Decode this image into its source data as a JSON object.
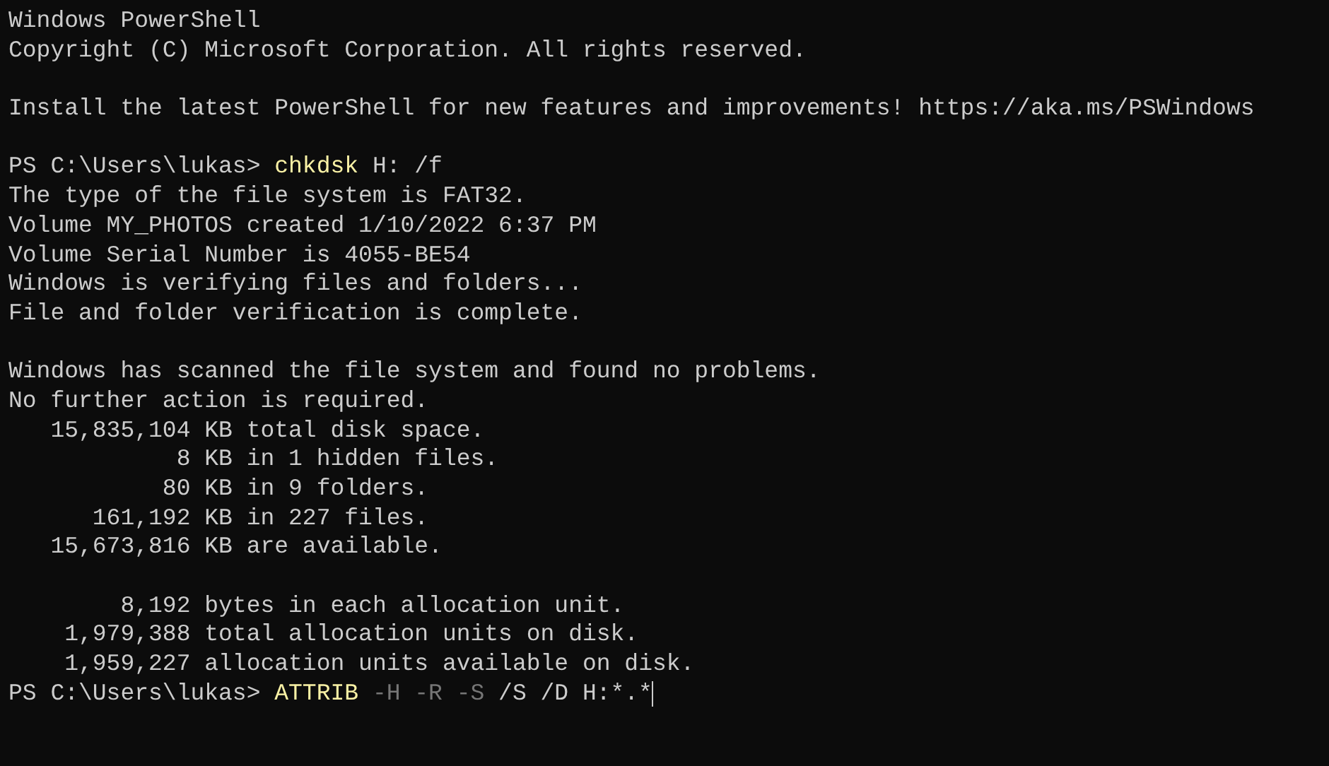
{
  "lines": [
    {
      "kind": "output",
      "text": "Windows PowerShell"
    },
    {
      "kind": "output",
      "text": "Copyright (C) Microsoft Corporation. All rights reserved."
    },
    {
      "kind": "blank"
    },
    {
      "kind": "output",
      "text": "Install the latest PowerShell for new features and improvements! https://aka.ms/PSWindows"
    },
    {
      "kind": "blank"
    },
    {
      "kind": "prompt",
      "prompt": "PS C:\\Users\\lukas>",
      "parts": [
        {
          "kind": "command",
          "text": "chkdsk"
        },
        {
          "kind": "argument",
          "text": "H:"
        },
        {
          "kind": "argument",
          "text": "/f"
        }
      ],
      "cursor": false
    },
    {
      "kind": "output",
      "text": "The type of the file system is FAT32."
    },
    {
      "kind": "output",
      "text": "Volume MY_PHOTOS created 1/10/2022 6:37 PM"
    },
    {
      "kind": "output",
      "text": "Volume Serial Number is 4055-BE54"
    },
    {
      "kind": "output",
      "text": "Windows is verifying files and folders..."
    },
    {
      "kind": "output",
      "text": "File and folder verification is complete."
    },
    {
      "kind": "blank"
    },
    {
      "kind": "output",
      "text": "Windows has scanned the file system and found no problems."
    },
    {
      "kind": "output",
      "text": "No further action is required."
    },
    {
      "kind": "output",
      "text": "   15,835,104 KB total disk space."
    },
    {
      "kind": "output",
      "text": "            8 KB in 1 hidden files."
    },
    {
      "kind": "output",
      "text": "           80 KB in 9 folders."
    },
    {
      "kind": "output",
      "text": "      161,192 KB in 227 files."
    },
    {
      "kind": "output",
      "text": "   15,673,816 KB are available."
    },
    {
      "kind": "blank"
    },
    {
      "kind": "output",
      "text": "        8,192 bytes in each allocation unit."
    },
    {
      "kind": "output",
      "text": "    1,979,388 total allocation units on disk."
    },
    {
      "kind": "output",
      "text": "    1,959,227 allocation units available on disk."
    },
    {
      "kind": "prompt",
      "prompt": "PS C:\\Users\\lukas>",
      "parts": [
        {
          "kind": "command",
          "text": "ATTRIB"
        },
        {
          "kind": "parameter",
          "text": "-H"
        },
        {
          "kind": "parameter",
          "text": "-R"
        },
        {
          "kind": "parameter",
          "text": "-S"
        },
        {
          "kind": "argument",
          "text": "/S"
        },
        {
          "kind": "argument",
          "text": "/D"
        },
        {
          "kind": "argument",
          "text": "H:*.*"
        }
      ],
      "cursor": true
    }
  ]
}
